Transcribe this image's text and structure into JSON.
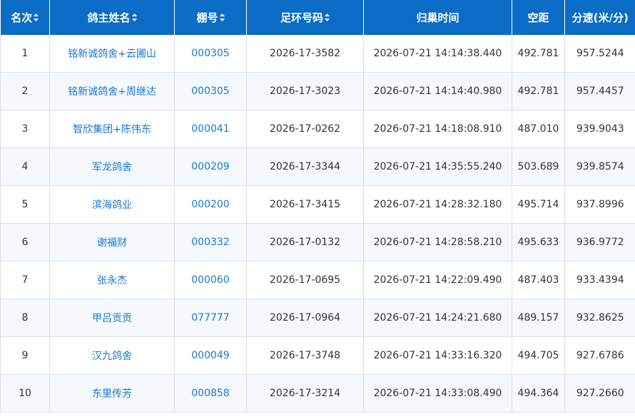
{
  "table": {
    "headers": {
      "rank": "名次",
      "name": "鸽主姓名",
      "loft": "棚号",
      "ring": "足环号码",
      "time": "归巢时间",
      "distance": "空距",
      "speed": "分速(米/分)"
    },
    "rows": [
      {
        "rank": "1",
        "name": "铭新诚鸽舍+云圃山",
        "loft": "000305",
        "ring": "2026-17-3582",
        "time": "2026-07-21 14:14:38.440",
        "distance": "492.781",
        "speed": "957.5244"
      },
      {
        "rank": "2",
        "name": "铭新诚鸽舍+周继达",
        "loft": "000305",
        "ring": "2026-17-3023",
        "time": "2026-07-21 14:14:40.980",
        "distance": "492.781",
        "speed": "957.4457"
      },
      {
        "rank": "3",
        "name": "智欣集团+陈伟东",
        "loft": "000041",
        "ring": "2026-17-0262",
        "time": "2026-07-21 14:18:08.910",
        "distance": "487.010",
        "speed": "939.9043"
      },
      {
        "rank": "4",
        "name": "军龙鸽舍",
        "loft": "000209",
        "ring": "2026-17-3344",
        "time": "2026-07-21 14:35:55.240",
        "distance": "503.689",
        "speed": "939.8574"
      },
      {
        "rank": "5",
        "name": "滨海鸽业",
        "loft": "000200",
        "ring": "2026-17-3415",
        "time": "2026-07-21 14:28:32.180",
        "distance": "495.714",
        "speed": "937.8996"
      },
      {
        "rank": "6",
        "name": "谢福财",
        "loft": "000332",
        "ring": "2026-17-0132",
        "time": "2026-07-21 14:28:58.210",
        "distance": "495.633",
        "speed": "936.9772"
      },
      {
        "rank": "7",
        "name": "张永杰",
        "loft": "000060",
        "ring": "2026-17-0695",
        "time": "2026-07-21 14:22:09.490",
        "distance": "487.403",
        "speed": "933.4394"
      },
      {
        "rank": "8",
        "name": "甲吕贡贡",
        "loft": "077777",
        "ring": "2026-17-0964",
        "time": "2026-07-21 14:24:21.680",
        "distance": "489.157",
        "speed": "932.8625"
      },
      {
        "rank": "9",
        "name": "汉九鸽舍",
        "loft": "000049",
        "ring": "2026-17-3748",
        "time": "2026-07-21 14:33:16.320",
        "distance": "494.705",
        "speed": "927.6786"
      },
      {
        "rank": "10",
        "name": "东里传芳",
        "loft": "000858",
        "ring": "2026-17-3214",
        "time": "2026-07-21 14:33:08.490",
        "distance": "494.364",
        "speed": "927.2660"
      }
    ]
  },
  "colors": {
    "header_bg": "#0a6cc4",
    "link": "#1a78d1",
    "stripe": "#f5f8fc"
  },
  "icons": {
    "sort": "sort-up-down-icon"
  }
}
